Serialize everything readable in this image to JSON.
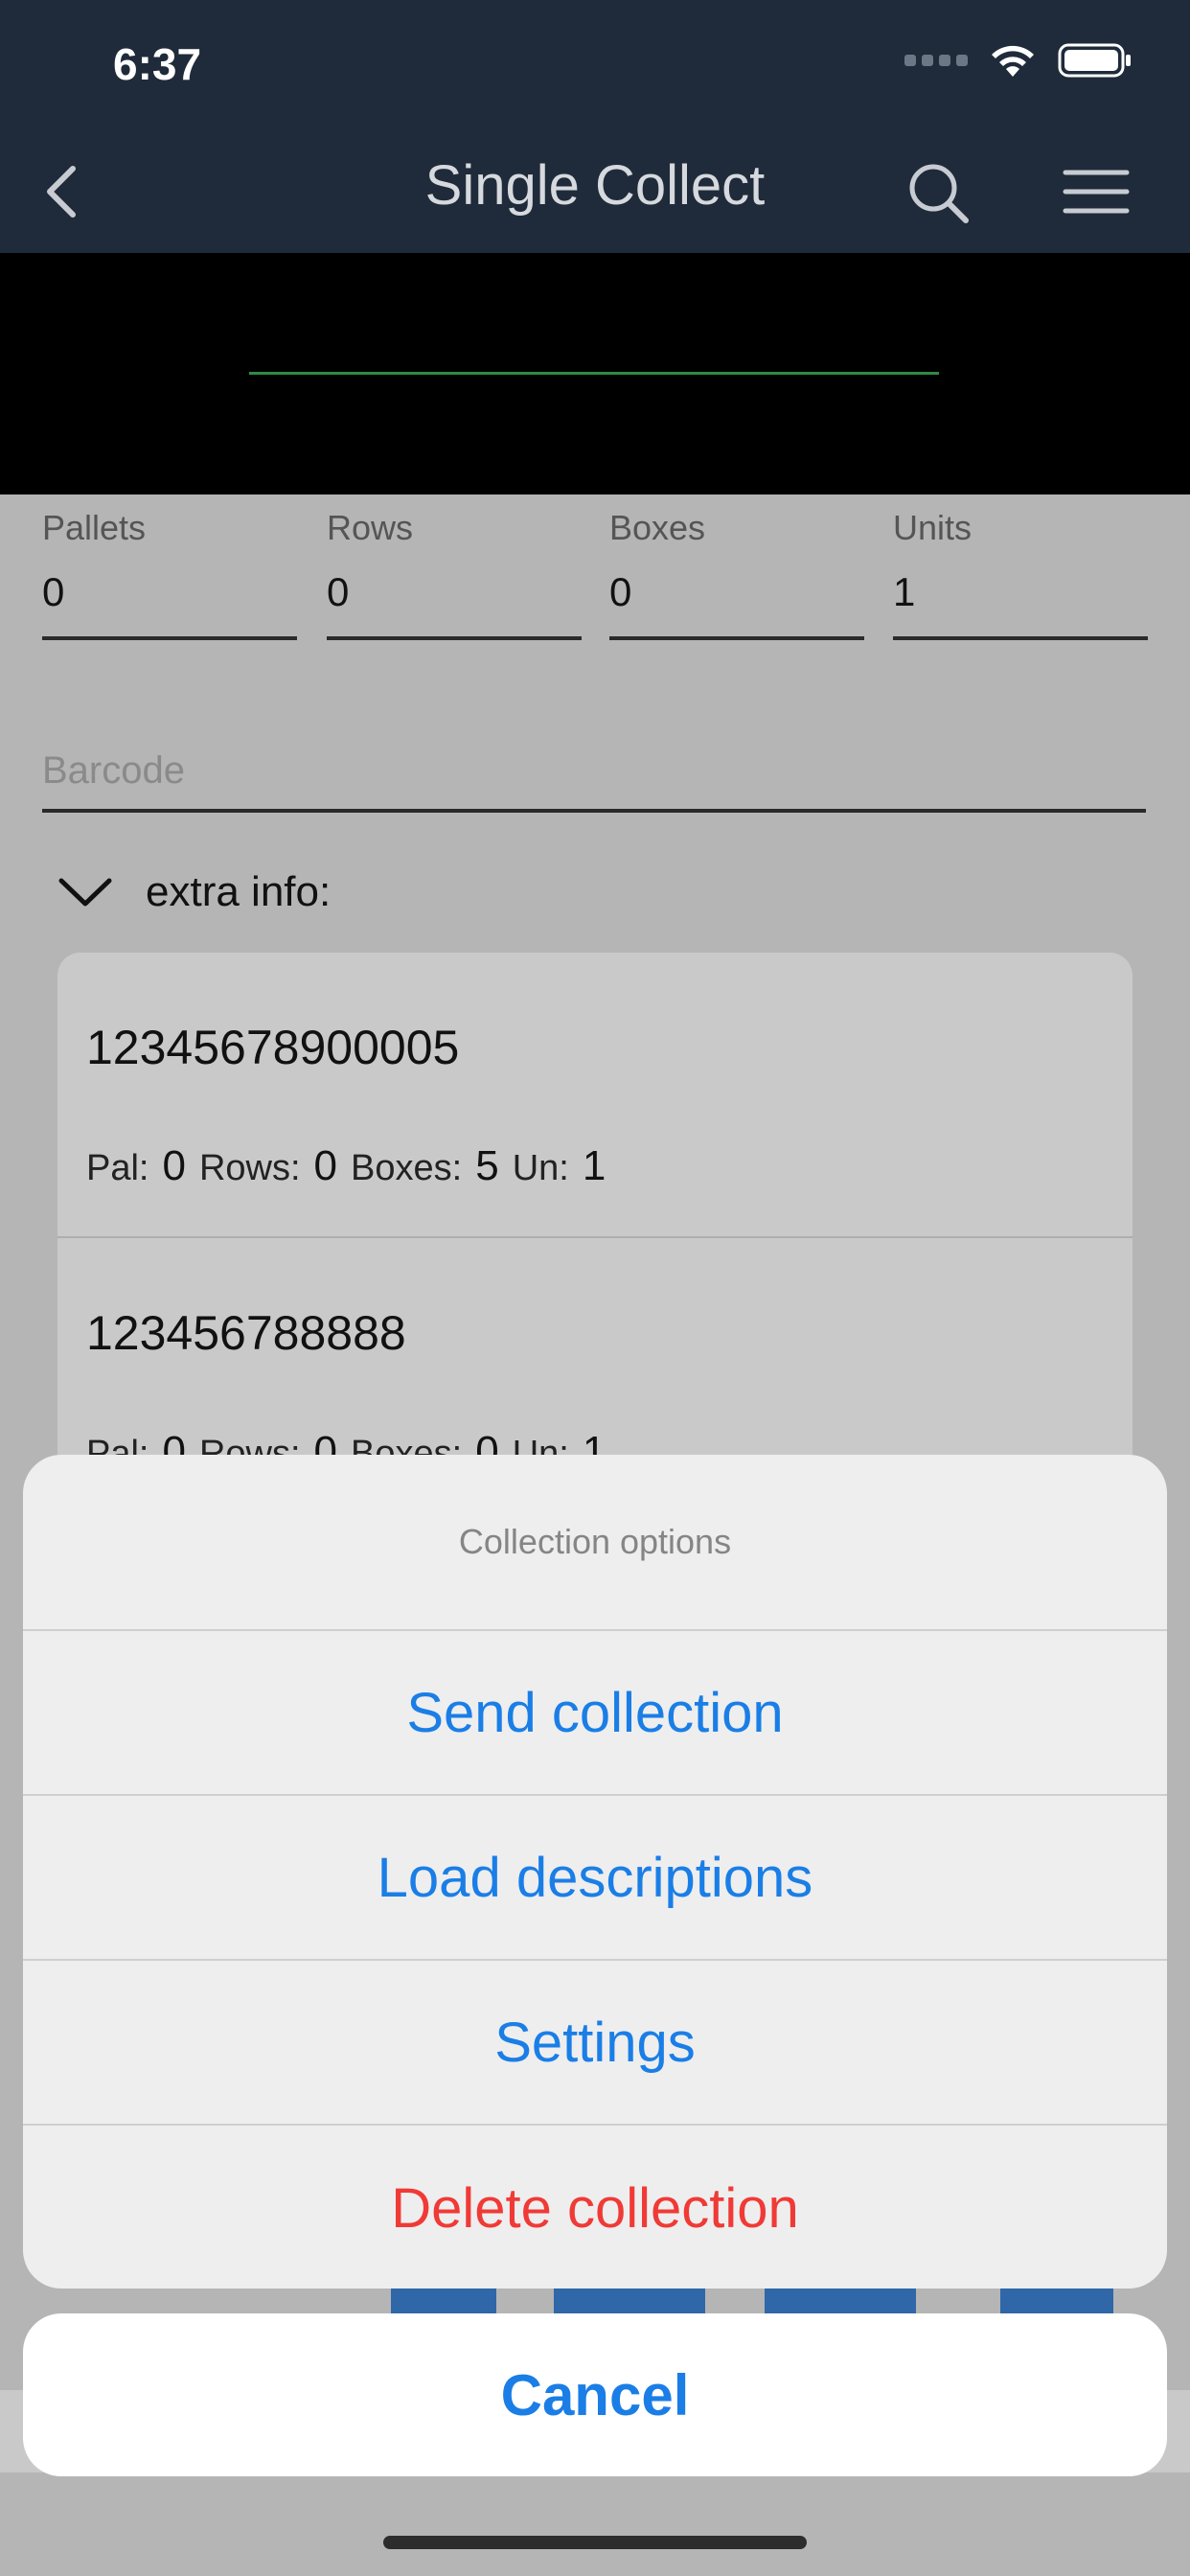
{
  "status_bar": {
    "time": "6:37"
  },
  "nav": {
    "title": "Single Collect"
  },
  "quantities": [
    {
      "label": "Pallets",
      "value": "0"
    },
    {
      "label": "Rows",
      "value": "0"
    },
    {
      "label": "Boxes",
      "value": "0"
    },
    {
      "label": "Units",
      "value": "1"
    }
  ],
  "barcode": {
    "placeholder": "Barcode",
    "value": ""
  },
  "extra_info": {
    "label": "extra info:"
  },
  "items": [
    {
      "code": "12345678900005",
      "pal_label": "Pal:",
      "pal": "0",
      "rows_label": "Rows:",
      "rows": "0",
      "boxes_label": "Boxes:",
      "boxes": "5",
      "un_label": "Un:",
      "un": "1"
    },
    {
      "code": "123456788888",
      "pal_label": "Pal:",
      "pal": "0",
      "rows_label": "Rows:",
      "rows": "0",
      "boxes_label": "Boxes:",
      "boxes": "0",
      "un_label": "Un:",
      "un": "1"
    }
  ],
  "action_sheet": {
    "title": "Collection options",
    "actions": [
      {
        "label": "Send collection"
      },
      {
        "label": "Load descriptions"
      },
      {
        "label": "Settings"
      },
      {
        "label": "Delete collection"
      }
    ],
    "cancel": "Cancel"
  },
  "colors": {
    "nav_background": "#1f2b3a",
    "action_blue": "#1a7ee6",
    "destructive_red": "#f03a36",
    "scan_line": "#2f8a45"
  }
}
